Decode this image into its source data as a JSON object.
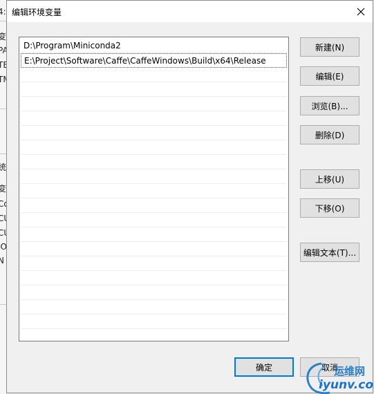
{
  "background": {
    "fragments": [
      "4:",
      "变",
      "PA",
      "TE",
      "TM",
      "统",
      "变",
      "Co",
      "CU",
      "CU",
      "IO",
      "N"
    ]
  },
  "dialog": {
    "title": "编辑环境变量",
    "close_icon": "close-icon"
  },
  "path_list": {
    "items": [
      "D:\\Program\\Miniconda2",
      "E:\\Project\\Software\\Caffe\\CaffeWindows\\Build\\x64\\Release"
    ],
    "selected_index": 1
  },
  "buttons": {
    "new": "新建(N)",
    "edit": "编辑(E)",
    "browse": "浏览(B)...",
    "delete": "删除(D)",
    "move_up": "上移(U)",
    "move_down": "下移(O)",
    "edit_text": "编辑文本(T)...",
    "ok": "确定",
    "cancel": "取消"
  },
  "watermark": {
    "top": "运维网",
    "bottom": "iyunv.com",
    "colors": {
      "ring": "#2a7fc9",
      "text": "#1a73c7"
    }
  }
}
